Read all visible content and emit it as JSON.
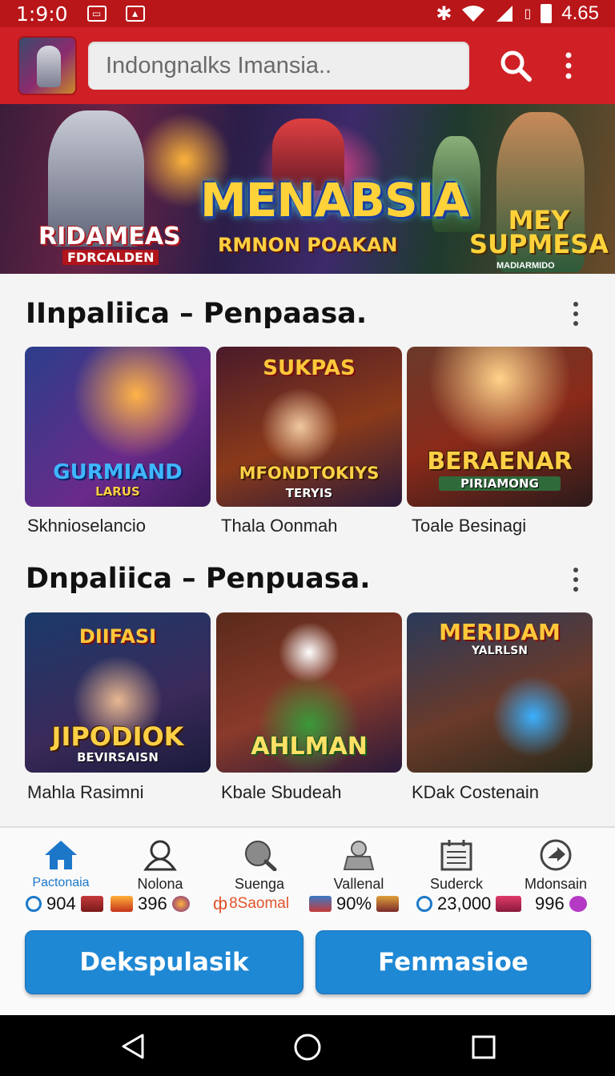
{
  "status_bar": {
    "time": "1:9:0",
    "battery": "4.65"
  },
  "app_bar": {
    "search_value": "Indongnalks Imansia.."
  },
  "banner": {
    "left_title": "RIDAMEAS",
    "left_subtitle": "FDRCALDEN",
    "title": "MENABSIA",
    "subtitle": "RMNON POAKAN",
    "right_title_line1": "MEY",
    "right_title_line2": "SUPMESA",
    "right_subtitle": "MADIARMIDO"
  },
  "sections": [
    {
      "title": "IInpaliica – Penpaasa.",
      "cards": [
        {
          "label": "Skhnioselancio",
          "art_title": "GURMIAND",
          "art_sub": "LARUS",
          "art_top": ""
        },
        {
          "label": "Thala Oonmah",
          "art_title": "MFONDTOKIYS",
          "art_sub": "TERYIS",
          "art_top": "SUKPAS"
        },
        {
          "label": "Toale Besinagi",
          "art_title": "BERAENAR",
          "art_sub": "PIRIAMONG",
          "art_top": ""
        }
      ]
    },
    {
      "title": "Dnpaliica – Penpuasa.",
      "cards": [
        {
          "label": "Mahla Rasimni",
          "art_title": "JIPODIOK",
          "art_sub": "BEVIRSAISN",
          "art_top": "DIIFASI"
        },
        {
          "label": "Kbale Sbudeah",
          "art_title": "AHLMAN",
          "art_sub": "",
          "art_top": ""
        },
        {
          "label": "KDak Costenain",
          "art_title": "",
          "art_sub": "YALRLSN",
          "art_top": "MERIDAM"
        }
      ]
    }
  ],
  "bottom_nav": {
    "items": [
      {
        "label": "Pactonaia",
        "icon": "home-icon"
      },
      {
        "label": "Nolona",
        "icon": "person-icon"
      },
      {
        "label": "Suenga",
        "icon": "heart-search-icon"
      },
      {
        "label": "Vallenal",
        "icon": "user-icon"
      },
      {
        "label": "Suderck",
        "icon": "calendar-icon"
      },
      {
        "label": "Mdonsain",
        "icon": "arrow-circle-icon"
      }
    ],
    "stats": [
      "904",
      "396",
      "8Saomal",
      "90%",
      "23,000",
      "996"
    ]
  },
  "buttons": {
    "left": "Dekspulasik",
    "right": "Fenmasioe"
  },
  "colors": {
    "accent": "#cf2026",
    "button": "#1f88d4",
    "active_nav": "#1c77c9"
  }
}
